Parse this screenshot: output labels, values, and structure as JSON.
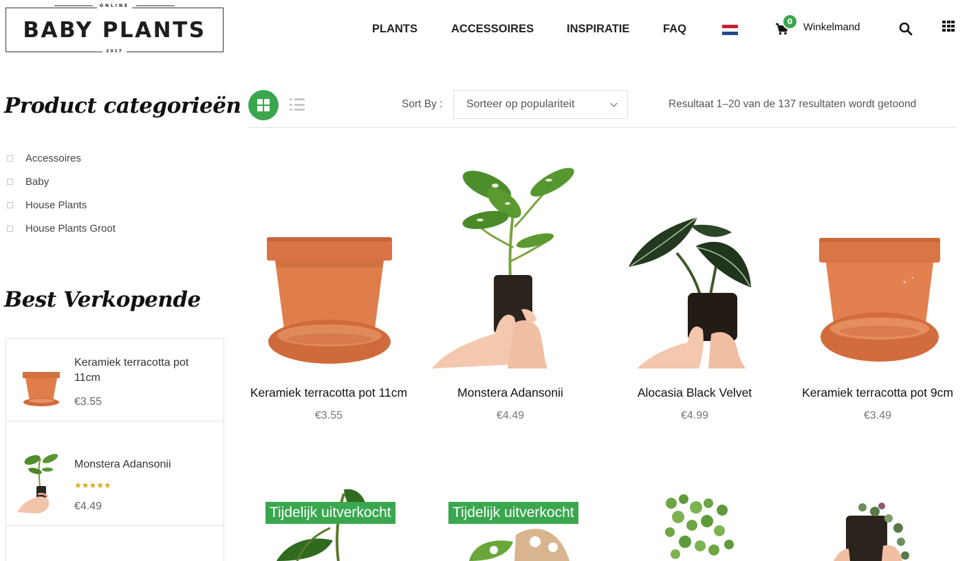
{
  "brand": {
    "top": "ONLINE",
    "name": "BABY PLANTS",
    "year": "2017"
  },
  "nav": {
    "items": [
      "PLANTS",
      "ACCESSOIRES",
      "INSPIRATIE",
      "FAQ"
    ],
    "language_flag": "flag-nl-icon",
    "cart_count": "0",
    "cart_label": "Winkelmand"
  },
  "sidebar": {
    "categories_title": "Product categorieën",
    "categories": [
      "Accessoires",
      "Baby",
      "House Plants",
      "House Plants Groot"
    ],
    "bestsellers_title": "Best Verkopende",
    "bestsellers": [
      {
        "name": "Keramiek terracotta pot 11cm",
        "price": "€3.55",
        "rating": null
      },
      {
        "name": "Monstera Adansonii",
        "price": "€4.49",
        "rating": 5
      }
    ]
  },
  "toolbar": {
    "sort_label": "Sort By :",
    "sort_value": "Sorteer op populariteit",
    "result_count": "Resultaat 1–20 van de 137 resultaten wordt getoond"
  },
  "products": [
    {
      "name": "Keramiek terracotta pot 11cm",
      "price": "€3.55"
    },
    {
      "name": "Monstera Adansonii",
      "price": "€4.49"
    },
    {
      "name": "Alocasia Black Velvet",
      "price": "€4.99"
    },
    {
      "name": "Keramiek terracotta pot 9cm",
      "price": "€3.49"
    }
  ],
  "products_row2": [
    {
      "badge": "Tijdelijk uitverkocht"
    },
    {
      "badge": "Tijdelijk uitverkocht"
    },
    {
      "badge": null
    },
    {
      "badge": null
    }
  ],
  "colors": {
    "accent_green": "#3aa74f",
    "terracotta": "#d97a4a",
    "star_gold": "#d6a91a"
  }
}
